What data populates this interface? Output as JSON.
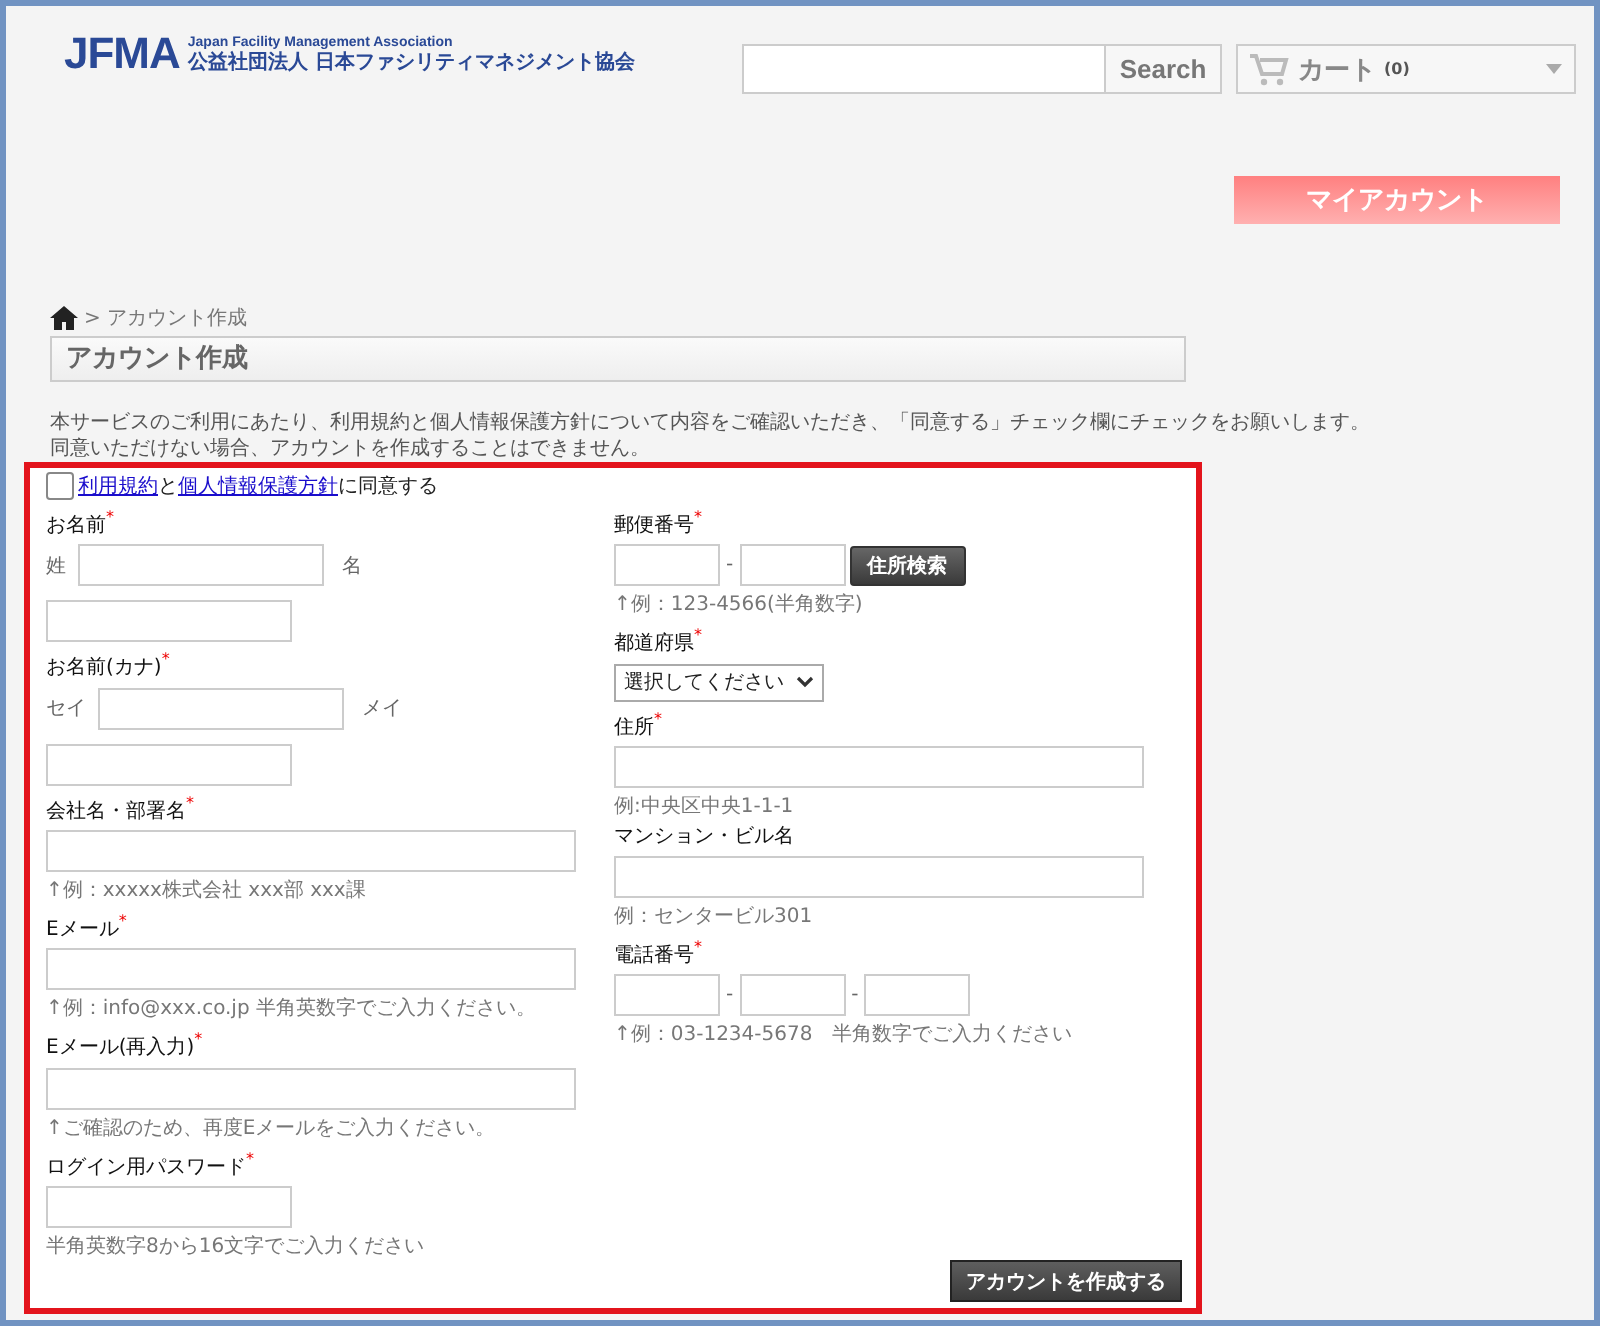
{
  "logo": {
    "mark": "JFMA",
    "en": "Japan Facility Management Association",
    "ja": "公益社団法人 日本ファシリティマネジメント協会"
  },
  "search": {
    "button": "Search"
  },
  "cart": {
    "label": "カート",
    "count": "(0)"
  },
  "account_button": "マイアカウント",
  "breadcrumb": {
    "current": "> アカウント作成"
  },
  "page_title": "アカウント作成",
  "notice": [
    "本サービスのご利用にあたり、利用規約と個人情報保護方針について内容をご確認いただき、「同意する」チェック欄にチェックをお願いします。",
    "同意いただけない場合、アカウントを作成することはできません。"
  ],
  "agree": {
    "checked": false,
    "parts": [
      {
        "kind": "link",
        "text": "利用規約"
      },
      {
        "kind": "text",
        "text": "と"
      },
      {
        "kind": "link",
        "text": "個人情報保護方針"
      },
      {
        "kind": "text",
        "text": "に同意する"
      }
    ]
  },
  "left_fields": [
    {
      "kind": "pair",
      "label": "お名前$^{*}$",
      "prefix1": "姓",
      "prefix2": "名"
    },
    {
      "kind": "pair",
      "label": "お名前(カナ)$^{*}$",
      "prefix1": "セイ",
      "prefix2": "メイ"
    },
    {
      "kind": "wide",
      "label": "会社名・部署名$^{*}$",
      "hint": "↑例：xxxxx株式会社 xxx部 xxx課"
    },
    {
      "kind": "wide",
      "label": "Eメール$^{*}$",
      "hint": "↑例：info@xxx.co.jp 半角英数字でご入力ください。"
    },
    {
      "kind": "wide",
      "label": "Eメール(再入力)$^{*}$",
      "hint": "↑ご確認のため、再度Eメールをご入力ください。"
    },
    {
      "kind": "short",
      "label": "ログイン用パスワード$^{*}$",
      "hint": "半角英数字8から16文字でご入力ください"
    }
  ],
  "right_fields": [
    {
      "kind": "zip",
      "label": "郵便番号$^{*}$",
      "separator": "-",
      "button": "住所検索",
      "hint": "↑例：123-4566(半角数字)"
    },
    {
      "kind": "select",
      "label": "都道府県$^{*}$",
      "value": "選択してください"
    },
    {
      "kind": "wide",
      "label": "住所$^{*}$",
      "hint": "例:中央区中央1-1-1"
    },
    {
      "kind": "wide",
      "label": "マンション・ビル名",
      "hint": "例：センタービル301"
    },
    {
      "kind": "phone",
      "label": "電話番号$^{*}$",
      "separators": [
        "-",
        "-"
      ],
      "hint": "↑例：03-1234-5678　半角数字でご入力ください"
    }
  ],
  "submit": "アカウントを作成する"
}
